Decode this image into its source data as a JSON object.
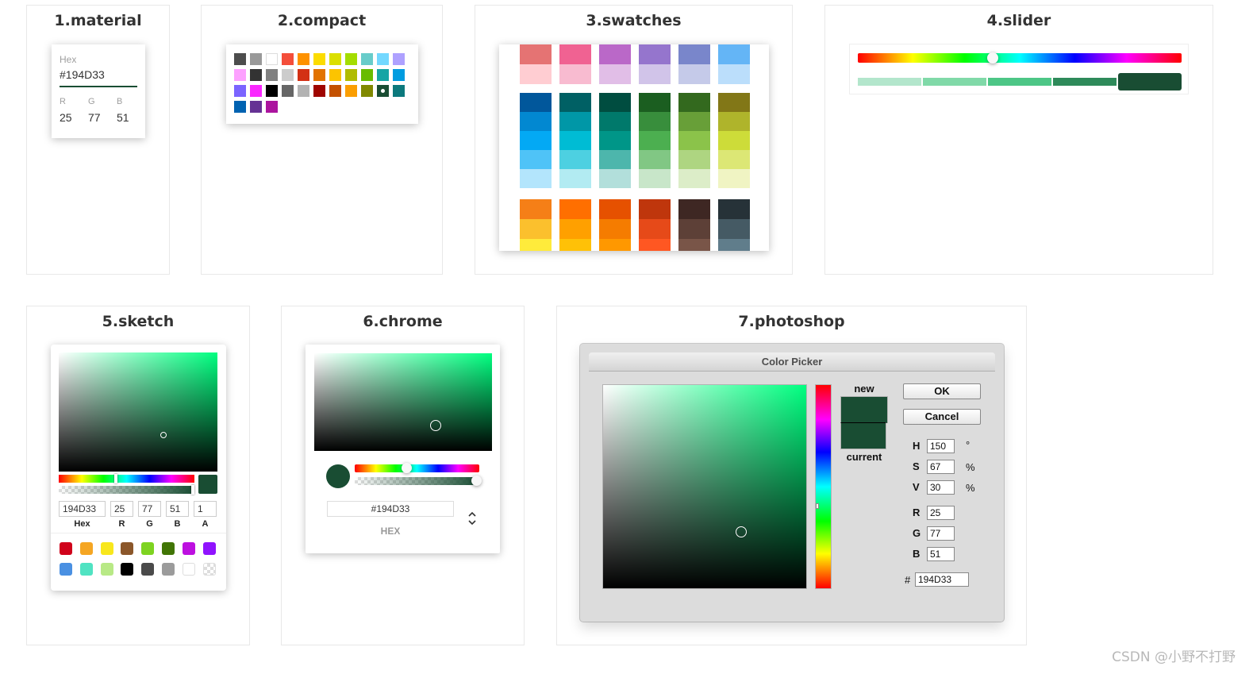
{
  "current_color": "#194D33",
  "material": {
    "title": "1.material",
    "hex_label": "Hex",
    "hex_value": "#194D33",
    "r_label": "R",
    "g_label": "G",
    "b_label": "B",
    "r": "25",
    "g": "77",
    "b": "51"
  },
  "compact": {
    "title": "2.compact",
    "colors": [
      "#4D4D4D",
      "#999999",
      "#FFFFFF",
      "#F44E3B",
      "#FE9200",
      "#FCDC00",
      "#DBDF00",
      "#A4DD00",
      "#68CCCA",
      "#73D8FF",
      "#AEA1FF",
      "#FDA1FF",
      "#333333",
      "#808080",
      "#CCCCCC",
      "#D33115",
      "#E27300",
      "#FCC400",
      "#B0BC00",
      "#68BC00",
      "#16A5A5",
      "#009CE0",
      "#7B64FF",
      "#FA28FF",
      "#000000",
      "#666666",
      "#B3B3B3",
      "#9F0500",
      "#C45100",
      "#FB9E00",
      "#808900",
      "#194D33",
      "#0C797D",
      "#0062B1",
      "#653294",
      "#AB149E"
    ],
    "selected_index": 31
  },
  "swatches": {
    "title": "3.swatches",
    "groups": [
      [
        [
          "#E57373",
          "#FFCDD2"
        ],
        [
          "#F06292",
          "#F8BBD0"
        ],
        [
          "#BA68C8",
          "#E1BEE7"
        ],
        [
          "#9575CD",
          "#D1C4E9"
        ],
        [
          "#7986CB",
          "#C5CAE9"
        ],
        [
          "#64B5F6",
          "#BBDEFB"
        ]
      ],
      [
        [
          "#01579B",
          "#0288D1",
          "#03A9F4",
          "#4FC3F7",
          "#B3E5FC"
        ],
        [
          "#006064",
          "#0097A7",
          "#00BCD4",
          "#4DD0E1",
          "#B2EBF2"
        ],
        [
          "#004D40",
          "#00796B",
          "#009688",
          "#4DB6AC",
          "#B2DFDB"
        ],
        [
          "#1B5E20",
          "#388E3C",
          "#4CAF50",
          "#81C784",
          "#C8E6C9"
        ],
        [
          "#33691E",
          "#689F38",
          "#8BC34A",
          "#AED581",
          "#DCEDC8"
        ],
        [
          "#827717",
          "#AFB42B",
          "#CDDC39",
          "#DCE775",
          "#F0F4C3"
        ]
      ],
      [
        [
          "#F57F17",
          "#FBC02D",
          "#FFEB3B"
        ],
        [
          "#FF6F00",
          "#FFA000",
          "#FFC107"
        ],
        [
          "#E65100",
          "#F57C00",
          "#FF9800"
        ],
        [
          "#BF360C",
          "#E64A19",
          "#FF5722"
        ],
        [
          "#3E2723",
          "#5D4037",
          "#795548"
        ],
        [
          "#263238",
          "#455A64",
          "#607D8B"
        ]
      ]
    ]
  },
  "slider": {
    "title": "4.slider",
    "hue_value": 150,
    "swatches": [
      "#B3E6CC",
      "#80D9A8",
      "#4DC686",
      "#2E8A5A",
      "#194D33"
    ],
    "selected_index": 4
  },
  "sketch": {
    "title": "5.sketch",
    "hex": "194D33",
    "r": "25",
    "g": "77",
    "b": "51",
    "a": "1",
    "labels": {
      "hex": "Hex",
      "r": "R",
      "g": "G",
      "b": "B",
      "a": "A"
    },
    "presets": [
      "#D0021B",
      "#F5A623",
      "#F8E71C",
      "#8B572A",
      "#7ED321",
      "#417505",
      "#BD10E0",
      "#9013FE",
      "#4A90E2",
      "#50E3C2",
      "#B8E986",
      "#000000",
      "#4A4A4A",
      "#9B9B9B",
      "#FFFFFF",
      "transparent"
    ]
  },
  "chrome": {
    "title": "6.chrome",
    "hex": "#194D33",
    "hex_label": "HEX"
  },
  "photoshop": {
    "title": "7.photoshop",
    "header": "Color Picker",
    "new_label": "new",
    "current_label": "current",
    "ok_label": "OK",
    "cancel_label": "Cancel",
    "h_label": "H",
    "s_label": "S",
    "v_label": "V",
    "r_label": "R",
    "g_label": "G",
    "b_label": "B",
    "hash_label": "#",
    "h": "150",
    "s": "67",
    "v": "30",
    "r": "25",
    "g": "77",
    "b": "51",
    "hex": "194D33",
    "deg_unit": "°",
    "pct_unit": "%"
  },
  "watermark": "CSDN @小野不打野"
}
